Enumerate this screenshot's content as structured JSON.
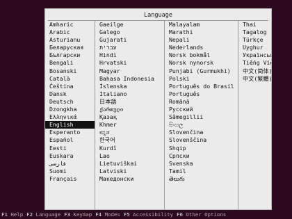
{
  "dialog": {
    "title": "Language",
    "selected": "English",
    "columns": [
      [
        "Amharic",
        "Arabic",
        "Asturianu",
        "Беларуская",
        "Български",
        "Bengali",
        "Bosanski",
        "Català",
        "Čeština",
        "Dansk",
        "Deutsch",
        "Dzongkha",
        "Ελληνικά",
        "English",
        "Esperanto",
        "Español",
        "Eesti",
        "Euskara",
        "فارسی",
        "Suomi",
        "Français"
      ],
      [
        "Gaeilge",
        "Galego",
        "Gujarati",
        "עברית",
        "Hindi",
        "Hrvatski",
        "Magyar",
        "Bahasa Indonesia",
        "Íslenska",
        "Italiano",
        "日本語",
        "ქართული",
        "Қазақ",
        "Khmer",
        "ಕನ್ನಡ",
        "한국어",
        "Kurdî",
        "Lao",
        "Lietuviškai",
        "Latviski",
        "Македонски"
      ],
      [
        "Malayalam",
        "Marathi",
        "Nepali",
        "Nederlands",
        "Norsk bokmål",
        "Norsk nynorsk",
        "Punjabi (Gurmukhi)",
        "Polski",
        "Português do Brasil",
        "Português",
        "Română",
        "Русский",
        "Sâmegillii",
        "සිංහල",
        "Slovenčina",
        "Slovenščina",
        "Shqip",
        "Српски",
        "Svenska",
        "Tamil",
        "తెలుగు"
      ],
      [
        "Thai",
        "Tagalog",
        "Türkçe",
        "Uyghur",
        "Українська",
        "Tiếng Việt",
        "中文(简体)",
        "中文(繁體)"
      ]
    ]
  },
  "footer": [
    {
      "key": "F1",
      "label": "Help"
    },
    {
      "key": "F2",
      "label": "Language"
    },
    {
      "key": "F3",
      "label": "Keymap"
    },
    {
      "key": "F4",
      "label": "Modes"
    },
    {
      "key": "F5",
      "label": "Accessibility"
    },
    {
      "key": "F6",
      "label": "Other Options"
    }
  ]
}
